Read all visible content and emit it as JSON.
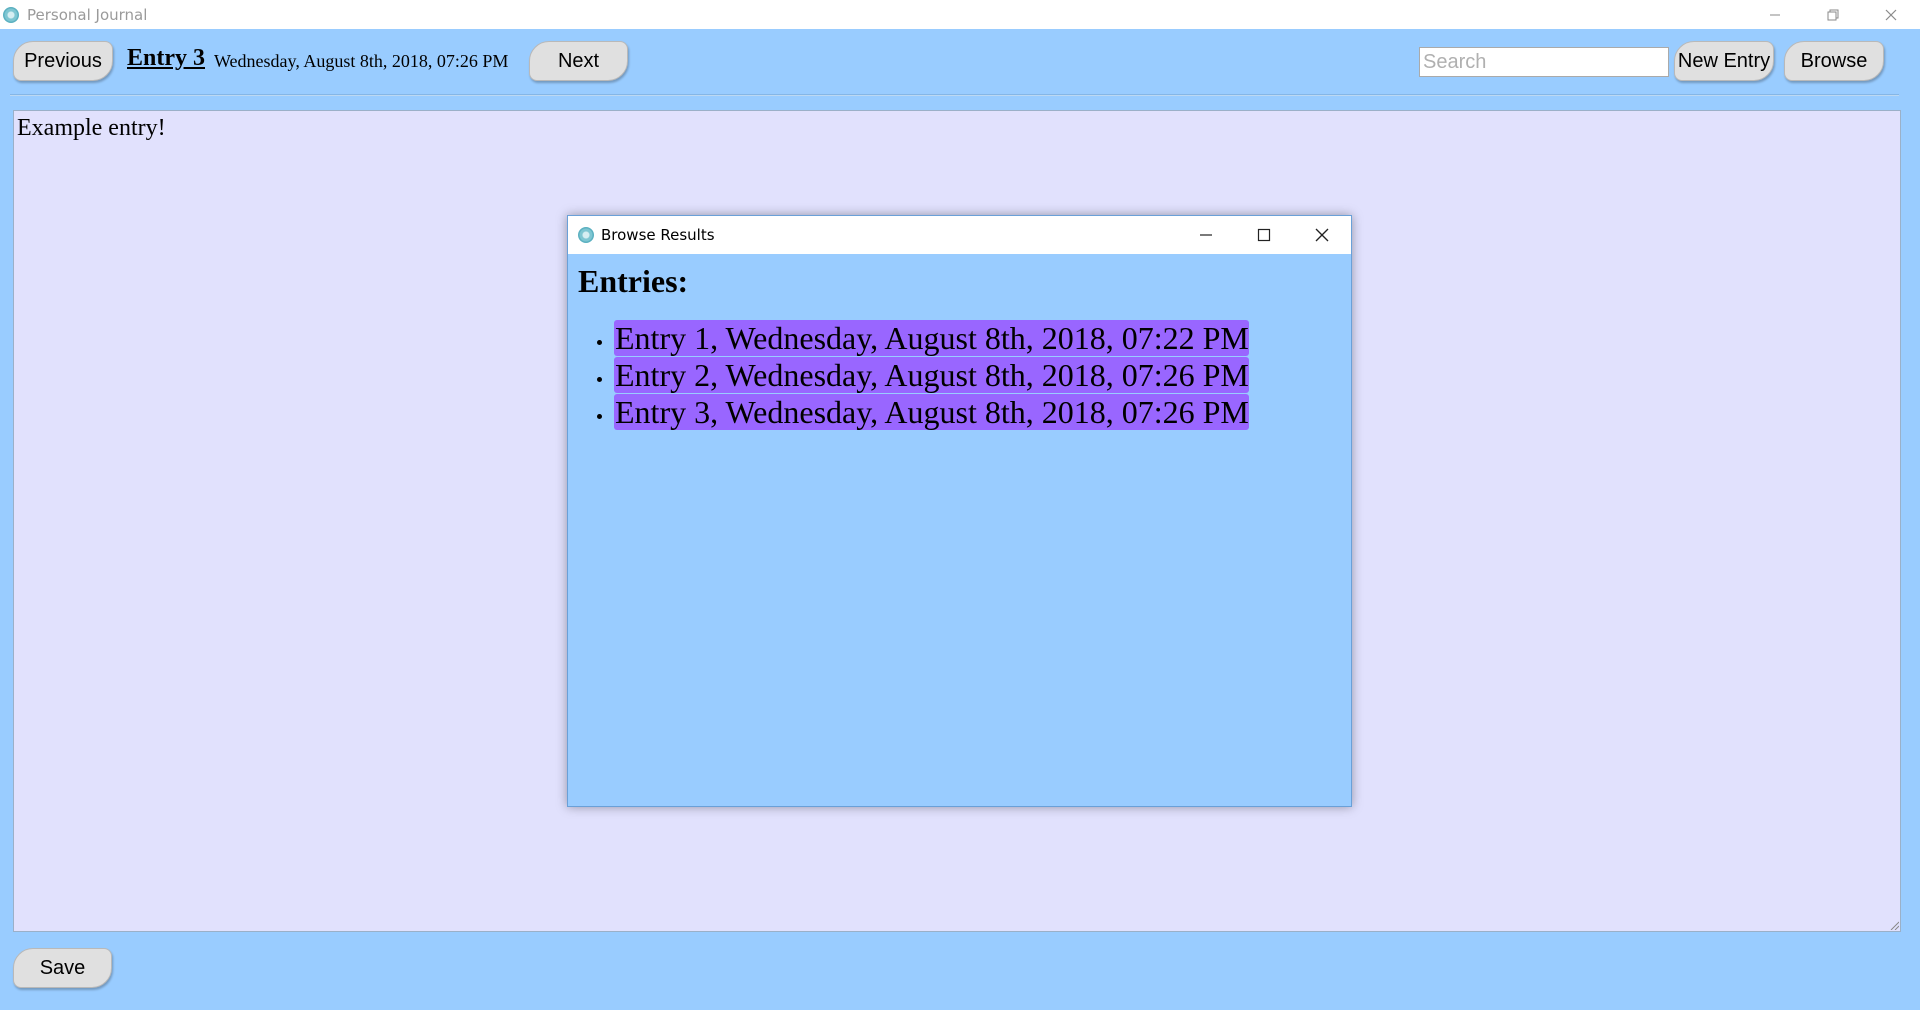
{
  "window": {
    "title": "Personal Journal",
    "icon": "app-icon",
    "controls": [
      "minimize-icon",
      "restore-icon",
      "close-icon"
    ]
  },
  "toolbar": {
    "previous_label": "Previous",
    "entry_title": "Entry 3",
    "entry_date": "Wednesday, August 8th, 2018, 07:26 PM",
    "next_label": "Next",
    "search_placeholder": "Search",
    "search_value": "",
    "new_entry_label": "New Entry",
    "browse_label": "Browse"
  },
  "editor": {
    "content": "Example entry!"
  },
  "footer": {
    "save_label": "Save"
  },
  "dialog": {
    "title": "Browse Results",
    "heading": "Entries:",
    "entries": [
      "Entry 1, Wednesday, August 8th, 2018, 07:22 PM",
      "Entry 2, Wednesday, August 8th, 2018, 07:26 PM",
      "Entry 3, Wednesday, August 8th, 2018, 07:26 PM"
    ]
  },
  "colors": {
    "background": "#99ccff",
    "editor_background": "#e1e1fd",
    "entry_highlight": "#9966ff",
    "button": "#e0e0e0"
  }
}
